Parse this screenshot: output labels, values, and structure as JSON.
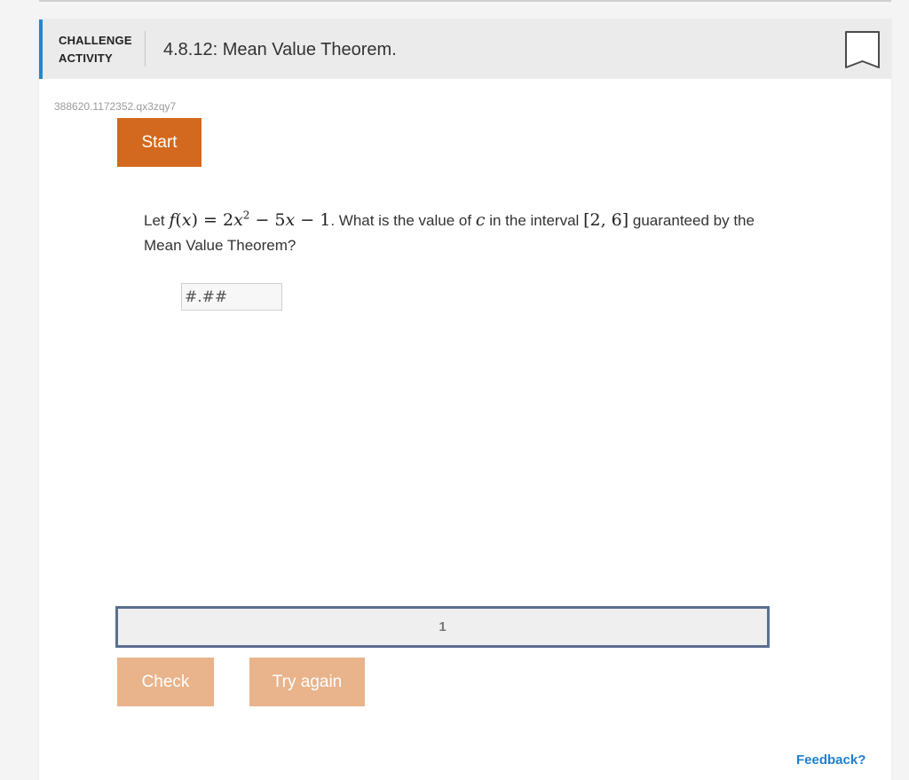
{
  "header": {
    "activity_label_line1": "CHALLENGE",
    "activity_label_line2": "ACTIVITY",
    "title": "4.8.12: Mean Value Theorem.",
    "accent_color": "#1e88d6"
  },
  "activity_id": "388620.1172352.qx3zqy7",
  "start_button": {
    "label": "Start",
    "color": "#d2691e"
  },
  "question": {
    "text_let": "Let",
    "func_expr": "f(x) = 2x² − 5x − 1",
    "text_middle": ". What is the value of",
    "var_c": "c",
    "text_interval": "in the interval",
    "interval": "[2, 6]",
    "text_end": "guaranteed by the Mean Value Theorem?"
  },
  "answer_input": {
    "placeholder": "#.##",
    "value": ""
  },
  "progress": {
    "steps": [
      "1"
    ],
    "border_color": "#5b6f8f"
  },
  "buttons": {
    "check_label": "Check",
    "try_again_label": "Try again",
    "disabled_color": "#e9b38b"
  },
  "feedback_link": "Feedback?"
}
